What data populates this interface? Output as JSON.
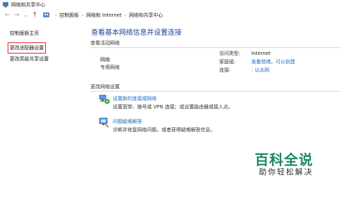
{
  "window": {
    "title": "网络和共享中心"
  },
  "addressbar": {
    "nav": {
      "back": "←",
      "forward": "→",
      "dropdown": "⌄",
      "up": "↑"
    },
    "breadcrumb": [
      "控制面板",
      "网络和 Internet",
      "网络和共享中心"
    ],
    "separator": "›"
  },
  "sidebar": {
    "items": [
      {
        "label": "控制面板主页"
      },
      {
        "label": "更改适配器设置"
      },
      {
        "label": "更改高级共享设置"
      }
    ]
  },
  "main": {
    "title": "查看基本网络信息并设置连接",
    "active_networks_label": "查看活动网络",
    "network": {
      "name": "网络",
      "type": "专用网络",
      "access_type_key": "访问类型:",
      "access_type_val": "Internet",
      "homegroup_key": "家庭组:",
      "homegroup_val": "准备就绪，可以创建",
      "connections_key": "连接:",
      "connections_val": "以太网"
    },
    "change_settings_label": "更改网络设置",
    "tasks": [
      {
        "link": "设置新的连接或网络",
        "desc": "设置宽带、拨号或 VPN 连接；或设置路由器或接入点。",
        "icon": "network-setup-icon"
      },
      {
        "link": "问题疑难解答",
        "desc": "诊断并修复网络问题，或者获得疑难解答信息。",
        "icon": "troubleshoot-icon"
      }
    ]
  },
  "watermark": {
    "title": "百科全说",
    "subtitle": "助你轻松解决"
  },
  "colors": {
    "link": "#1a6dbf",
    "title": "#1f3f99",
    "highlight": "#e0262b",
    "watermark": "#1a8a5a"
  }
}
